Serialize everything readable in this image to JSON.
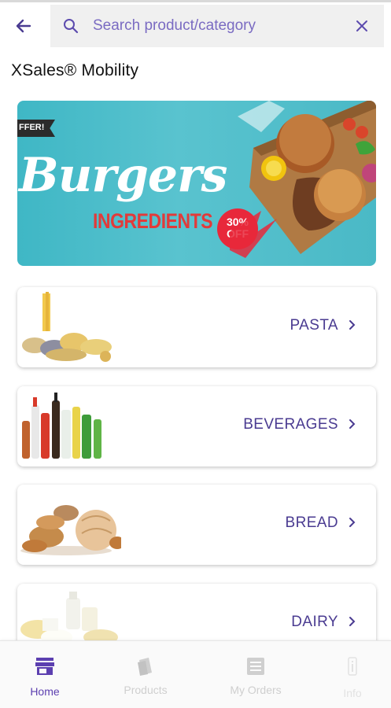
{
  "search": {
    "placeholder": "Search product/category",
    "value": ""
  },
  "app": {
    "title": "XSales® Mobility"
  },
  "banner": {
    "tag": "FFER!",
    "title": "Burgers",
    "subtitle": "INGREDIENTS",
    "discount_line1": "30%",
    "discount_line2": "OFF"
  },
  "categories": [
    {
      "label": "PASTA"
    },
    {
      "label": "BEVERAGES"
    },
    {
      "label": "BREAD"
    },
    {
      "label": "DAIRY"
    }
  ],
  "nav": {
    "items": [
      {
        "label": "Home",
        "active": true
      },
      {
        "label": "Products",
        "active": false
      },
      {
        "label": "My Orders",
        "active": false
      },
      {
        "label": "Info",
        "active": false
      }
    ]
  },
  "colors": {
    "accent": "#5c3fb0",
    "text_purple": "#4a3b91",
    "inactive": "#c8c8c8",
    "banner_bg": "#4ab9c6",
    "badge_red": "#e8283b"
  },
  "icons": {
    "back": "arrow-left-icon",
    "search": "search-icon",
    "clear": "close-icon",
    "chevron": "chevron-right-icon",
    "home": "store-icon",
    "products": "products-icon",
    "orders": "orders-icon",
    "info": "info-icon"
  }
}
